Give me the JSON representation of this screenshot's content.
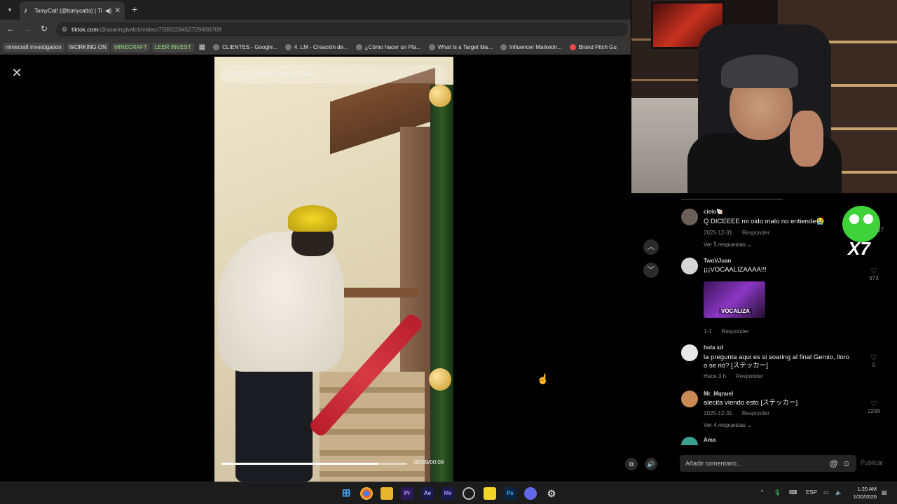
{
  "browser": {
    "tab": {
      "title": "TomyCat! (@tomycatts) | Ti",
      "favicon": "tiktok-icon"
    },
    "url_host": "tiktok.com",
    "url_path": "/@soaringtwitch/video/7590228452729490708",
    "bookmarks": [
      {
        "label": "minecraft investigation",
        "style": "boxed"
      },
      {
        "label": "WORKING ON",
        "style": "boxed"
      },
      {
        "label": "MINECRAFT",
        "style": "boxed-green"
      },
      {
        "label": "LEER INVEST",
        "style": "boxed-green"
      },
      {
        "label": "CLIENTES - Google...",
        "style": "plain"
      },
      {
        "label": "4. LM - Creación de...",
        "style": "plain"
      },
      {
        "label": "¿Cómo hacer un Pla...",
        "style": "plain"
      },
      {
        "label": "What Is a Target Ma...",
        "style": "plain"
      },
      {
        "label": "Influencer Marketin...",
        "style": "plain"
      },
      {
        "label": "Brand Pitch Gu",
        "style": "red"
      }
    ]
  },
  "video": {
    "search_placeholder": "Buscar contenido relacionado",
    "time": "00:09/00:09",
    "progress": 0.84
  },
  "comments": [
    {
      "user": "cielo🐚",
      "text": "Q DICEEEE mi oido malo no entiende😭",
      "date": "2025-12-31",
      "reply": "Responder",
      "replies": "Ver 5 respuestas ⌄",
      "likes": ""
    },
    {
      "user": "TwoVJuan",
      "text": "¡¡¡VOCAALIZAAAA!!!",
      "date": "1-1",
      "reply": "Responder",
      "image_caption": "VOCALIZA",
      "likes": "973"
    },
    {
      "user": "hola xd",
      "text": "la pregunta aqui es si soaring al final Gemio, lloro o se rió? [ステッカー]",
      "date": "Hace 3 h",
      "reply": "Responder",
      "likes": "0"
    },
    {
      "user": "Mr_Mqnuel",
      "text": "alecita viendo esto [ステッカー]",
      "date": "2025-12-31",
      "reply": "Responder",
      "replies": "Ver 4 respuestas ⌄",
      "likes": "2299"
    },
    {
      "user": "Ama",
      "text": "",
      "date": "",
      "reply": "",
      "likes": ""
    }
  ],
  "sticker": {
    "label": "X7",
    "side": "67"
  },
  "comment_input": {
    "placeholder": "Añadir comentario...",
    "publish": "Publicar"
  },
  "taskbar": {
    "apps": [
      "Pr",
      "Ae",
      "Me",
      "Ps"
    ],
    "lang": "ESP",
    "time": "1:20 AM",
    "date": "1/20/2026"
  }
}
